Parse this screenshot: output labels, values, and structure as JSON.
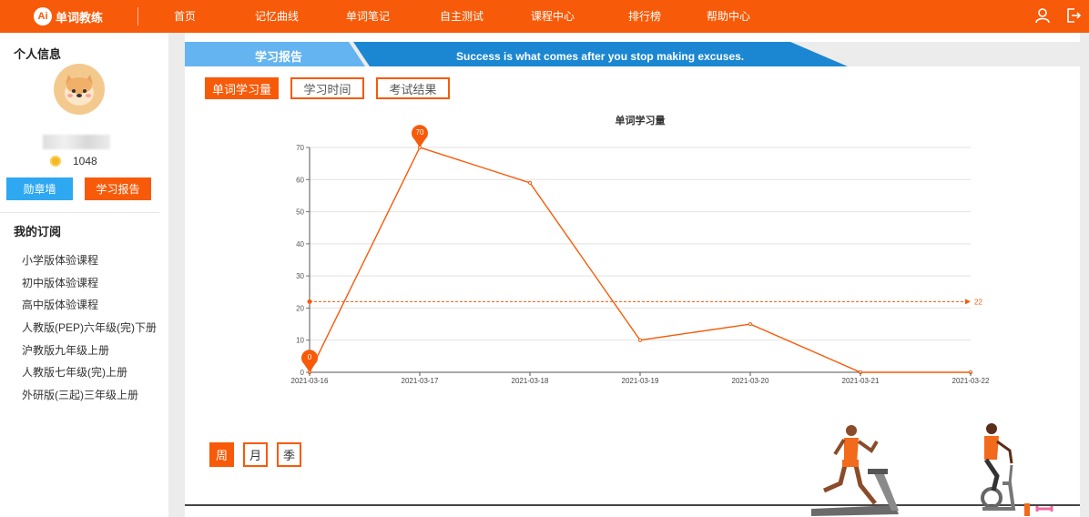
{
  "app": {
    "logo_badge": "Ai",
    "logo_text": "单词教练"
  },
  "nav": [
    "首页",
    "记忆曲线",
    "单词笔记",
    "自主测试",
    "课程中心",
    "排行榜",
    "帮助中心"
  ],
  "sidebar": {
    "profile_heading": "个人信息",
    "coins": "1048",
    "badge_wall_label": "勋章墙",
    "report_label": "学习报告",
    "subscriptions_heading": "我的订阅",
    "subscriptions": [
      "小学版体验课程",
      "初中版体验课程",
      "高中版体验课程",
      "人教版(PEP)六年级(完)下册",
      "沪教版九年级上册",
      "人教版七年级(完)上册",
      "外研版(三起)三年级上册"
    ]
  },
  "report": {
    "title": "学习报告",
    "motto": "Success is what comes after you stop making excuses."
  },
  "tabs": {
    "words": "单词学习量",
    "time": "学习时间",
    "exam": "考试结果"
  },
  "periods": {
    "week": "周",
    "month": "月",
    "season": "季"
  },
  "colors": {
    "accent": "#f75a08",
    "blue": "#2ea8f0",
    "banner_blue": "#1b87d2",
    "banner_light": "#63b4f0"
  },
  "chart_data": {
    "type": "line",
    "title": "单词学习量",
    "x": [
      "2021-03-16",
      "2021-03-17",
      "2021-03-18",
      "2021-03-19",
      "2021-03-20",
      "2021-03-21",
      "2021-03-22"
    ],
    "values": [
      0,
      70,
      59,
      10,
      15,
      0,
      0
    ],
    "ylim": [
      0,
      70
    ],
    "yticks": [
      0,
      10,
      20,
      30,
      40,
      50,
      60,
      70
    ],
    "average": 22,
    "markers": {
      "max": 70,
      "min": 0
    },
    "grid": true,
    "legend": "none"
  }
}
